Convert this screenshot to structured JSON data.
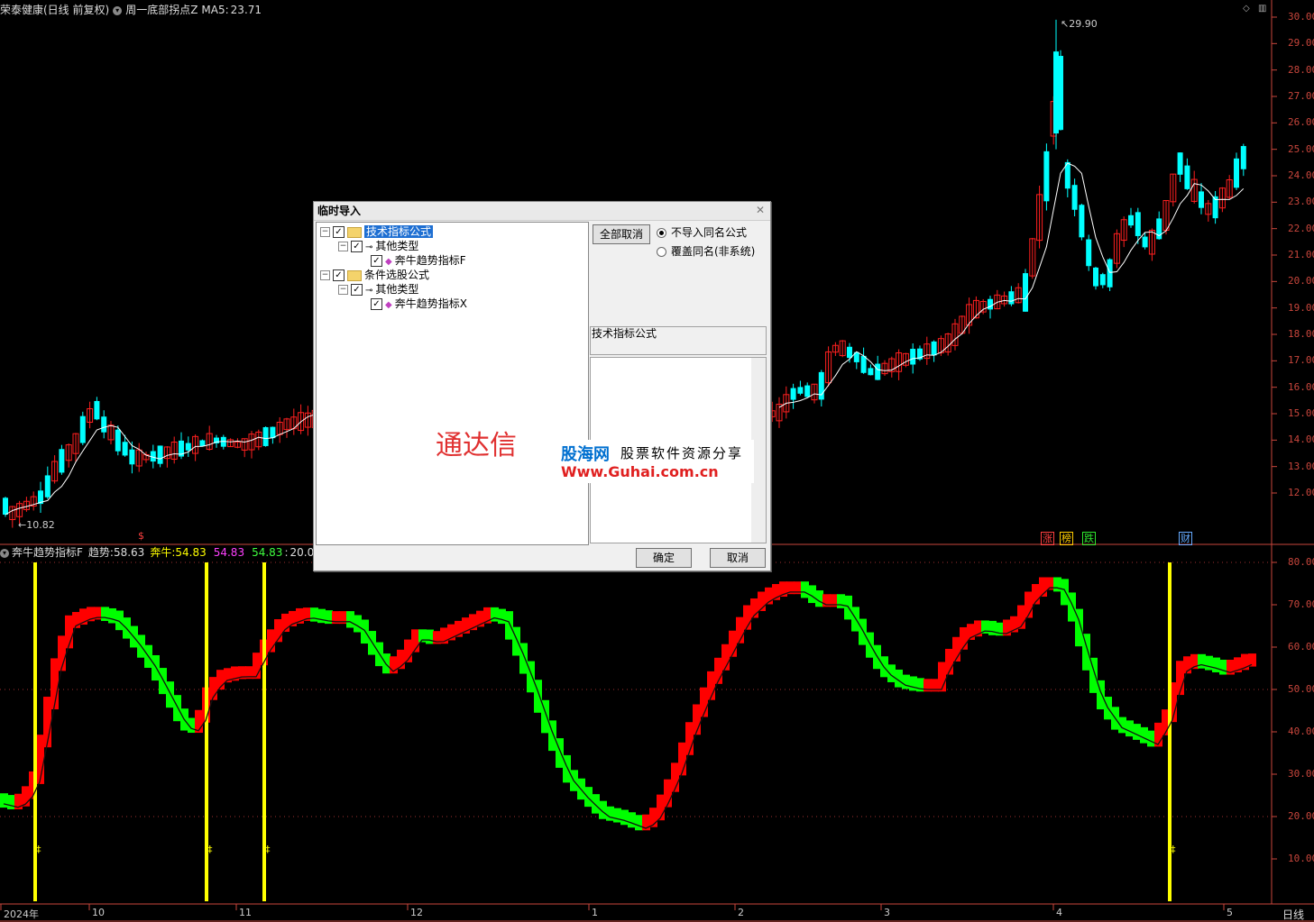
{
  "header": {
    "stock_name": "荣泰健康(日线 前复权)",
    "formula": "周一底部拐点Z",
    "ma_label": "MA5:",
    "ma_value": "23.71"
  },
  "price_axis": [
    "30.00",
    "29.00",
    "28.00",
    "27.00",
    "26.00",
    "25.00",
    "24.00",
    "23.00",
    "22.00",
    "21.00",
    "20.00",
    "19.00",
    "18.00",
    "17.00",
    "16.00",
    "15.00",
    "14.00",
    "13.00",
    "12.00"
  ],
  "price_annotations": {
    "high": "29.90",
    "low": "10.82"
  },
  "event_marks": [
    {
      "text": "$",
      "color": "#ff4040"
    },
    {
      "text": "涨",
      "color": "#ff4040"
    },
    {
      "text": "榜",
      "color": "#ffcc00"
    },
    {
      "text": "跌",
      "color": "#2ee62e"
    },
    {
      "text": "财",
      "color": "#66aaff"
    }
  ],
  "indicator_header": {
    "name": "奔牛趋势指标F",
    "trend_label": "趋势:",
    "trend_value": "58.63",
    "bull_label": "奔牛:",
    "bull_value": "54.83",
    "val3": "54.83",
    "val4": "54.83",
    "val5": "20.0"
  },
  "indicator_axis": [
    "80.00",
    "70.00",
    "60.00",
    "50.00",
    "40.00",
    "30.00",
    "20.00",
    "10.00"
  ],
  "x_axis": [
    "2024年",
    "10",
    "11",
    "12",
    "1",
    "2",
    "3",
    "4",
    "5"
  ],
  "period_label": "日线",
  "dialog": {
    "title": "临时导入",
    "tree": {
      "root1": "技术指标公式",
      "child1": "其他类型",
      "leaf1": "奔牛趋势指标F",
      "root2": "条件选股公式",
      "child2": "其他类型",
      "leaf2": "奔牛趋势指标X"
    },
    "watermark": "通达信",
    "cancel_all": "全部取消",
    "radio1": "不导入同名公式",
    "radio2": "覆盖同名(非系统)",
    "info_label": "技术指标公式",
    "ok": "确定",
    "cancel": "取消"
  },
  "guhai": {
    "brand": "股海网",
    "slogan": "股票软件资源分享",
    "url": "Www.Guhai.com.cn"
  },
  "colors": {
    "axis": "#c8463c",
    "up": "#ff2020",
    "down": "#00ffff",
    "ind_up": "#ff0000",
    "ind_down": "#00ff00",
    "signal": "#ffff00"
  }
}
